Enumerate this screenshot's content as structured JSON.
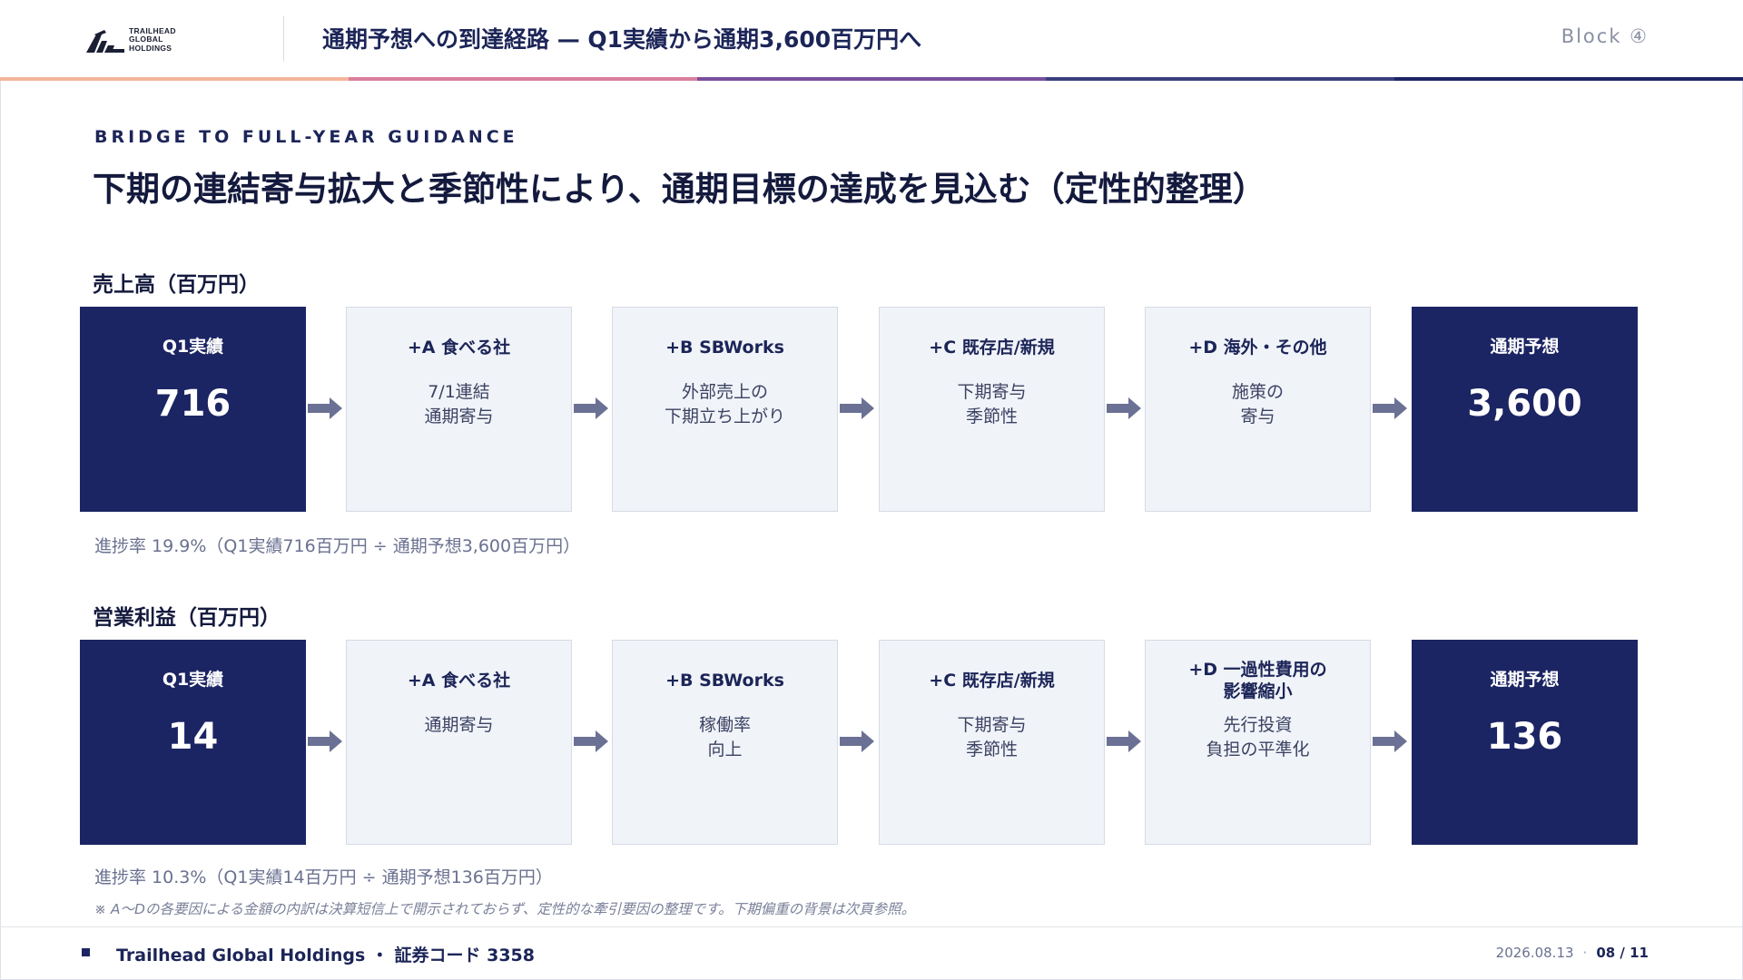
{
  "header": {
    "logo_lines": [
      "TRAILHEAD",
      "GLOBAL",
      "HOLDINGS"
    ],
    "title": "通期予想への到達経路 — Q1実績から通期3,600百万円へ",
    "block": "Block ④",
    "stripe_colors": [
      "#f3b59a",
      "#d9809c",
      "#7a4f9e",
      "#3b3f7e",
      "#1c2563"
    ]
  },
  "eyebrow": "BRIDGE TO FULL-YEAR GUIDANCE",
  "main_title": "下期の連結寄与拡大と季節性により、通期目標の達成を見込む（定性的整理）",
  "sales": {
    "title": "売上高（百万円）",
    "start": {
      "label": "Q1実績",
      "value": "716"
    },
    "steps": [
      {
        "label": "+A 食べる社",
        "desc": "7/1連結\n通期寄与"
      },
      {
        "label": "+B SBWorks",
        "desc": "外部売上の\n下期立ち上がり"
      },
      {
        "label": "+C 既存店/新規",
        "desc": "下期寄与\n季節性"
      },
      {
        "label": "+D 海外・その他",
        "desc": "施策の\n寄与"
      }
    ],
    "end": {
      "label": "通期予想",
      "value": "3,600"
    },
    "note": "進捗率 19.9%（Q1実績716百万円 ÷ 通期予想3,600百万円）"
  },
  "profit": {
    "title": "営業利益（百万円）",
    "start": {
      "label": "Q1実績",
      "value": "14"
    },
    "steps": [
      {
        "label": "+A 食べる社",
        "desc": "通期寄与"
      },
      {
        "label": "+B SBWorks",
        "desc": "稼働率\n向上"
      },
      {
        "label": "+C 既存店/新規",
        "desc": "下期寄与\n季節性"
      },
      {
        "label": "+D 一過性費用の\n影響縮小",
        "desc": "先行投資\n負担の平準化"
      }
    ],
    "end": {
      "label": "通期予想",
      "value": "136"
    },
    "note": "進捗率 10.3%（Q1実績14百万円 ÷ 通期予想136百万円）"
  },
  "footnote": "※ A〜Dの各要因による金額の内訳は決算短信上で開示されておらず、定性的な牽引要因の整理です。下期偏重の背景は次頁参照。",
  "footer": {
    "company": "Trailhead Global Holdings ・ 証券コード 3358",
    "date": "2026.08.13",
    "separator": "·",
    "page": "08 / 11"
  },
  "colors": {
    "navy": "#1c2563",
    "light_box": "#f0f3f8",
    "arrow": "#6b7194"
  },
  "icons": {
    "logo": "trailhead-logo-mark",
    "arrow": "right-arrow-icon",
    "footer_marker": "square-marker-icon"
  }
}
